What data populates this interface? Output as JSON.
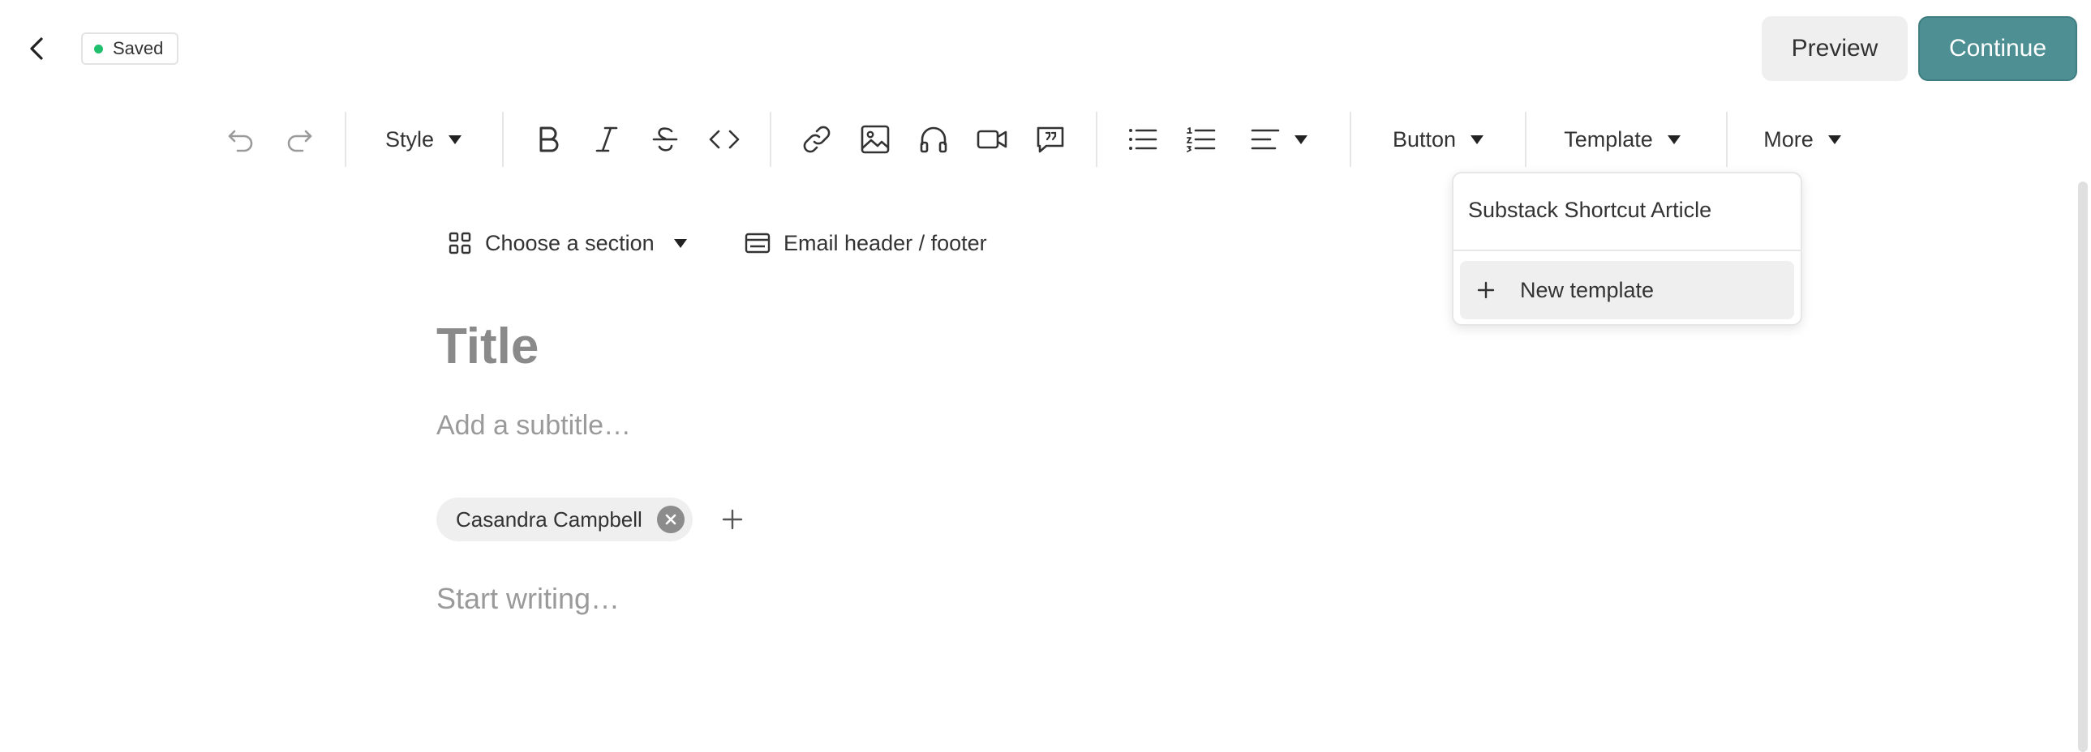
{
  "header": {
    "saved_label": "Saved",
    "preview_label": "Preview",
    "continue_label": "Continue"
  },
  "toolbar": {
    "style_label": "Style",
    "button_label": "Button",
    "template_label": "Template",
    "more_label": "More"
  },
  "section_row": {
    "choose_section_label": "Choose a section",
    "email_header_footer_label": "Email header / footer"
  },
  "editor": {
    "title_placeholder": "Title",
    "subtitle_placeholder": "Add a subtitle…",
    "body_placeholder": "Start writing…",
    "authors": [
      "Casandra Campbell"
    ]
  },
  "template_menu": {
    "items": [
      "Substack Shortcut Article"
    ],
    "new_template_label": "New template"
  },
  "colors": {
    "accent": "#4d8f93",
    "saved_dot": "#1fbf6e"
  }
}
